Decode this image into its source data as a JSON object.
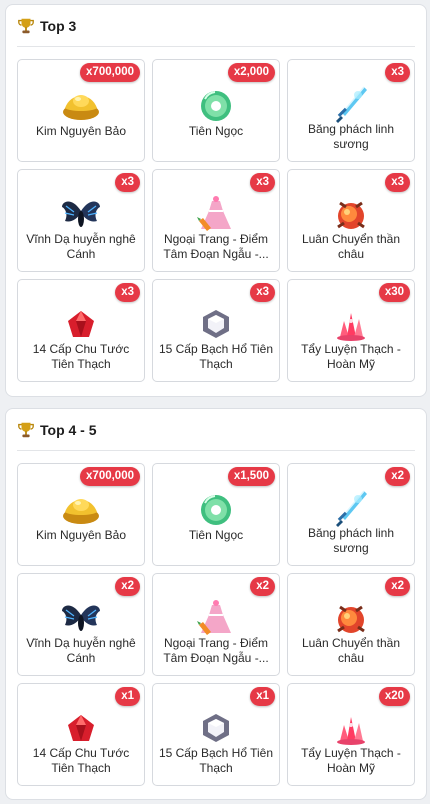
{
  "sections": [
    {
      "title": "Top 3",
      "icon": "trophy-icon",
      "items": [
        {
          "name": "Kim Nguyên Bảo",
          "qty": "x700,000",
          "icon": "gold-ingot-icon"
        },
        {
          "name": "Tiên Ngọc",
          "qty": "x2,000",
          "icon": "jade-disc-icon"
        },
        {
          "name": "Băng phách linh sương",
          "qty": "x3",
          "icon": "ice-sword-icon"
        },
        {
          "name": "Vĩnh Dạ huyễn nghê Cánh",
          "qty": "x3",
          "icon": "dark-wings-icon"
        },
        {
          "name": "Ngoại Trang - Điểm Tâm Đoạn Ngẫu -...",
          "qty": "x3",
          "icon": "pink-dress-icon"
        },
        {
          "name": "Luân Chuyển thần châu",
          "qty": "x3",
          "icon": "fire-orb-icon"
        },
        {
          "name": "14 Cấp Chu Tước Tiên Thạch",
          "qty": "x3",
          "icon": "red-gem-icon"
        },
        {
          "name": "15 Cấp Bạch Hổ Tiên Thạch",
          "qty": "x3",
          "icon": "white-gem-icon"
        },
        {
          "name": "Tẩy Luyện Thạch - Hoàn Mỹ",
          "qty": "x30",
          "icon": "pink-crystal-icon"
        }
      ]
    },
    {
      "title": "Top 4 - 5",
      "icon": "trophy-icon",
      "items": [
        {
          "name": "Kim Nguyên Bảo",
          "qty": "x700,000",
          "icon": "gold-ingot-icon"
        },
        {
          "name": "Tiên Ngọc",
          "qty": "x1,500",
          "icon": "jade-disc-icon"
        },
        {
          "name": "Băng phách linh sương",
          "qty": "x2",
          "icon": "ice-sword-icon"
        },
        {
          "name": "Vĩnh Dạ huyễn nghê Cánh",
          "qty": "x2",
          "icon": "dark-wings-icon"
        },
        {
          "name": "Ngoại Trang - Điểm Tâm Đoạn Ngẫu -...",
          "qty": "x2",
          "icon": "pink-dress-icon"
        },
        {
          "name": "Luân Chuyển thần châu",
          "qty": "x2",
          "icon": "fire-orb-icon"
        },
        {
          "name": "14 Cấp Chu Tước Tiên Thạch",
          "qty": "x1",
          "icon": "red-gem-icon"
        },
        {
          "name": "15 Cấp Bạch Hổ Tiên Thạch",
          "qty": "x1",
          "icon": "white-gem-icon"
        },
        {
          "name": "Tẩy Luyện Thạch - Hoàn Mỹ",
          "qty": "x20",
          "icon": "pink-crystal-icon"
        }
      ]
    }
  ],
  "colors": {
    "badge": "#e63946",
    "trophy": "#d4a017"
  }
}
